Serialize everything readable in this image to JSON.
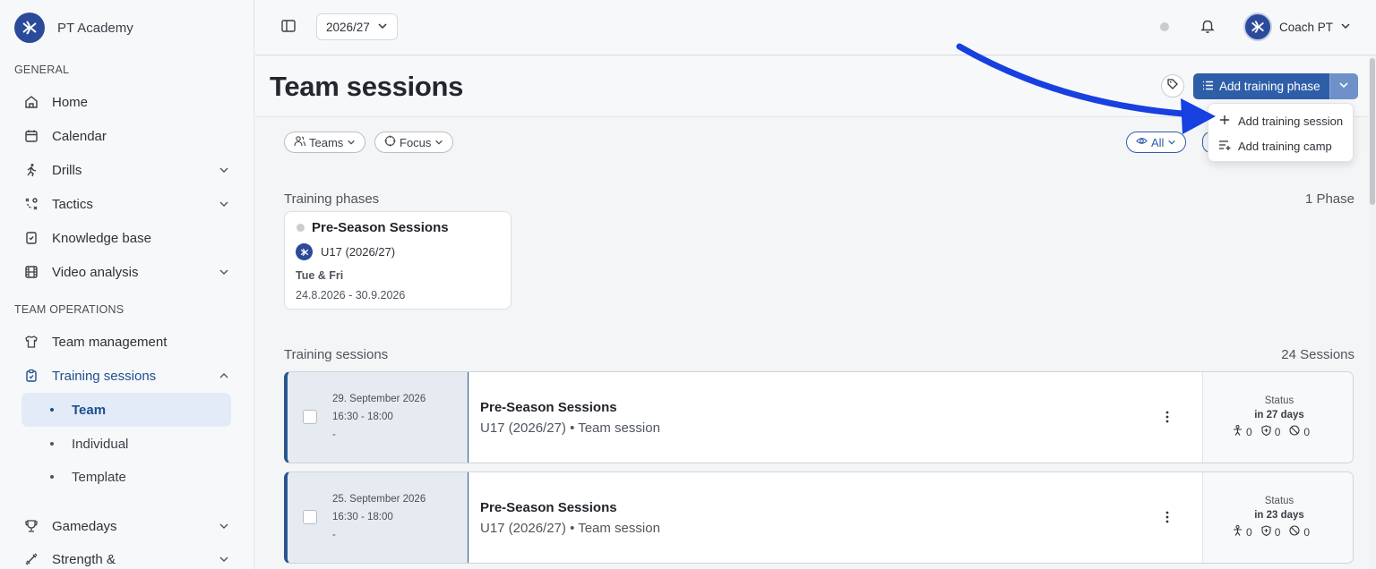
{
  "app": {
    "name": "PT Academy"
  },
  "sidebar": {
    "sections": {
      "general": "GENERAL",
      "team_operations": "TEAM OPERATIONS"
    },
    "items": {
      "home": "Home",
      "calendar": "Calendar",
      "drills": "Drills",
      "tactics": "Tactics",
      "knowledge_base": "Knowledge base",
      "video_analysis": "Video analysis",
      "team_management": "Team management",
      "training_sessions": "Training sessions",
      "gamedays": "Gamedays",
      "strength": "Strength &"
    },
    "sub_items": {
      "team": "Team",
      "individual": "Individual",
      "template": "Template"
    }
  },
  "topbar": {
    "season": "2026/27",
    "user_name": "Coach PT"
  },
  "page": {
    "title": "Team sessions",
    "add_button_label": "Add training phase",
    "filters": {
      "teams": "Teams",
      "focus": "Focus",
      "all": "All"
    }
  },
  "dropdown": {
    "add_session": "Add training session",
    "add_camp": "Add training camp"
  },
  "phases": {
    "title": "Training phases",
    "count": "1 Phase",
    "card": {
      "name": "Pre-Season Sessions",
      "team": "U17 (2026/27)",
      "days": "Tue & Fri",
      "dates": "24.8.2026 - 30.9.2026"
    }
  },
  "sessions": {
    "title": "Training sessions",
    "count": "24 Sessions",
    "status_label": "Status",
    "items": [
      {
        "date": "29. September 2026",
        "time": "16:30 - 18:00",
        "extra": "-",
        "title": "Pre-Season Sessions",
        "subtitle": "U17 (2026/27) • Team session",
        "status": "in 27 days",
        "c1": "0",
        "c2": "0",
        "c3": "0"
      },
      {
        "date": "25. September 2026",
        "time": "16:30 - 18:00",
        "extra": "-",
        "title": "Pre-Season Sessions",
        "subtitle": "U17 (2026/27) • Team session",
        "status": "in 23 days",
        "c1": "0",
        "c2": "0",
        "c3": "0"
      }
    ]
  },
  "colors": {
    "accent": "#2f5ea8",
    "sidebar_active": "#1e4f8f",
    "annotation_arrow": "#1740e0"
  }
}
